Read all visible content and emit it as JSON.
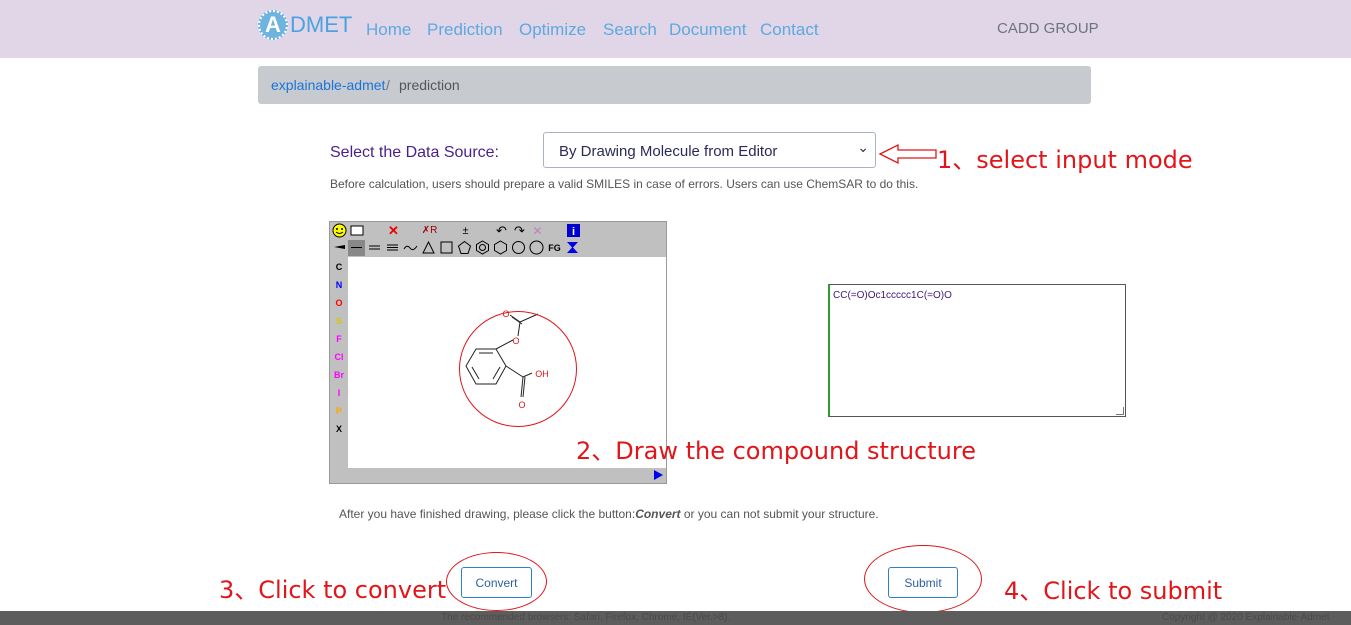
{
  "navbar": {
    "logo_letter": "A",
    "logo_text": "DMET",
    "links": [
      "Home",
      "Prediction",
      "Optimize",
      "Search",
      "Document",
      "Contact"
    ],
    "right_text": "CADD GROUP"
  },
  "breadcrumb": {
    "link": "explainable-admet",
    "separator": "/",
    "current": "prediction"
  },
  "data_source": {
    "label": "Select the Data Source:",
    "selected": "By Drawing Molecule from Editor",
    "chevron": "⌄"
  },
  "hint": "Before calculation, users should prepare a valid SMILES in case of errors. Users can use ChemSAR to do this.",
  "editor": {
    "atoms": [
      "C",
      "N",
      "O",
      "S",
      "F",
      "Cl",
      "Br",
      "I",
      "P",
      "X"
    ],
    "toolbar_fg": "FG",
    "molecule_labels": {
      "o1": "O",
      "o2": "O",
      "oh": "OH",
      "o3": "O"
    }
  },
  "smiles": {
    "value": "CC(=O)Oc1ccccc1C(=O)O"
  },
  "after_text": {
    "before": "After you have finished drawing, please click the button:",
    "emph": "Convert",
    "after": " or you can not submit your structure."
  },
  "buttons": {
    "convert": "Convert",
    "submit": "Submit"
  },
  "annotations": {
    "step1": "1、select input mode",
    "step2": "2、Draw the compound structure",
    "step3": "3、Click to convert",
    "step4": "4、Click to submit"
  },
  "footer": {
    "browsers": "The recommended browsers: Safari, Firefox, Chrome, IE(Ver.>8).",
    "copyright": "Copyright @ 2020 Explainable-Admet"
  },
  "colors": {
    "navbar_bg": "#e0d6e8",
    "nav_link": "#5ea9dd",
    "annotation_red": "#e0161b",
    "primary_blue": "#2f7fc9"
  }
}
